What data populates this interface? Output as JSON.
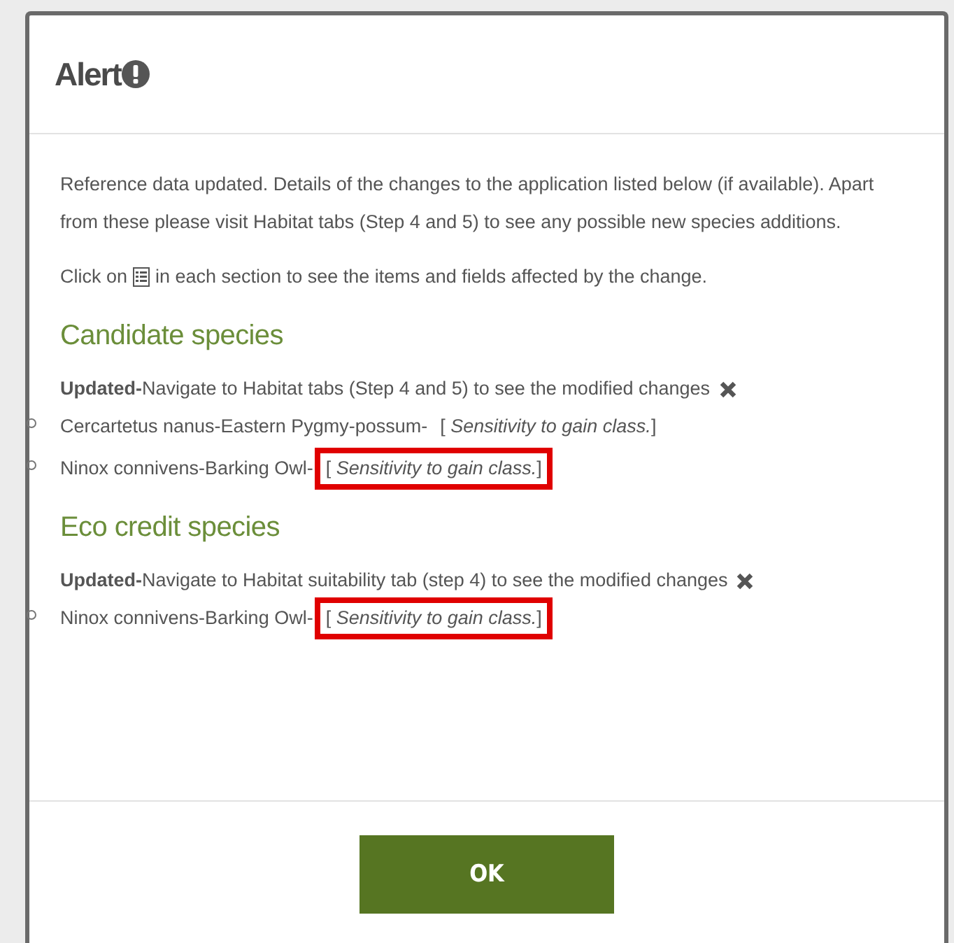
{
  "dialog": {
    "title": "Alert",
    "intro": "Reference data updated. Details of the changes to the application listed below (if available). Apart from these please visit Habitat tabs (Step 4 and 5) to see any possible new species additions.",
    "hint_before": "Click on",
    "hint_after": "in each section to see the items and fields affected by the change.",
    "sections": [
      {
        "heading": "Candidate species",
        "update": "**Updated-**Navigate to Habitat tabs (Step 4 and 5) to see the modified changes",
        "items": [
          {
            "name": "Cercartetus nanus-Eastern Pygmy-possum-",
            "detail": "[ *Sensitivity to gain class.*]",
            "highlighted": false
          },
          {
            "name": "Ninox connivens-Barking Owl-",
            "detail": "[ *Sensitivity to gain class.*]",
            "highlighted": true
          }
        ]
      },
      {
        "heading": "Eco credit species",
        "update": "**Updated-**Navigate to Habitat suitability tab (step 4) to see the modified changes",
        "items": [
          {
            "name": "Ninox connivens-Barking Owl-",
            "detail": "[ *Sensitivity to gain class.*]",
            "highlighted": true
          }
        ]
      }
    ],
    "ok_button": "OK"
  }
}
